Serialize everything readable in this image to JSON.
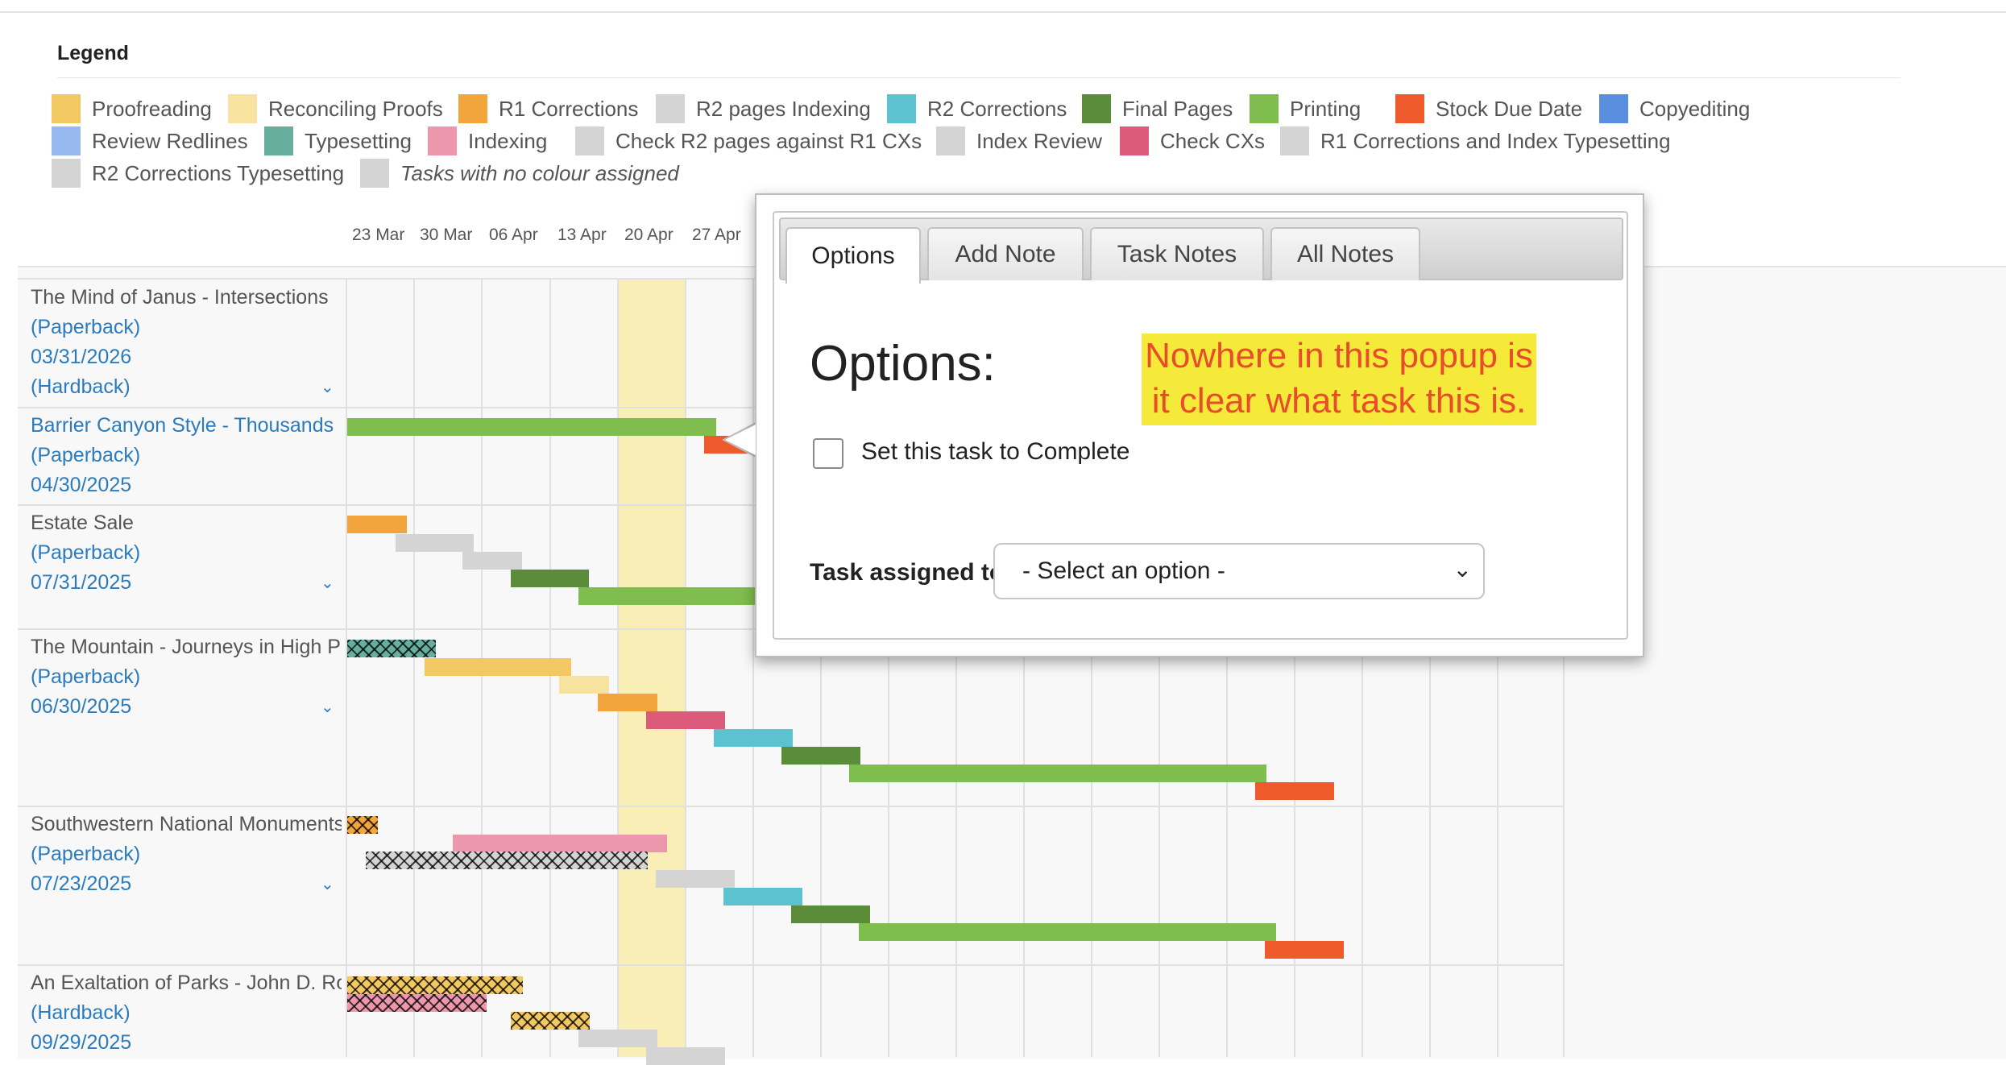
{
  "legend": {
    "title": "Legend",
    "items": [
      {
        "label": "Proofreading",
        "color": "#f2c862"
      },
      {
        "label": "Reconciling Proofs",
        "color": "#f8e2a0"
      },
      {
        "label": "R1 Corrections",
        "color": "#f2a53c"
      },
      {
        "label": "R2 pages Indexing",
        "color": "#d4d4d4"
      },
      {
        "label": "R2 Corrections",
        "color": "#5cc2cf"
      },
      {
        "label": "Final Pages",
        "color": "#5b8c3a"
      },
      {
        "label": "Printing",
        "color": "#7fbd4e"
      },
      {
        "label": "Stock Due Date",
        "color": "#ee5a2b"
      },
      {
        "label": "Copyediting",
        "color": "#5a8fe0"
      },
      {
        "label": "Review Redlines",
        "color": "#98b9f0"
      },
      {
        "label": "Typesetting",
        "color": "#67ae9e"
      },
      {
        "label": "Indexing",
        "color": "#ec97ab"
      },
      {
        "label": "Check R2 pages against R1 CXs",
        "color": "#d4d4d4"
      },
      {
        "label": "Index Review",
        "color": "#d4d4d4"
      },
      {
        "label": "Check CXs",
        "color": "#dc5a7a"
      },
      {
        "label": "R1 Corrections and Index Typesetting",
        "color": "#d4d4d4"
      },
      {
        "label": "R2 Corrections Typesetting",
        "color": "#d4d4d4"
      },
      {
        "label": "Tasks with no colour assigned",
        "color": "#d4d4d4",
        "italic": true
      }
    ]
  },
  "dates": [
    "23 Mar",
    "30 Mar",
    "06 Apr",
    "13 Apr",
    "20 Apr",
    "27 Apr"
  ],
  "rows": [
    {
      "title": "The Mind of Janus - Intersections",
      "lines": [
        "(Paperback)",
        "03/31/2026",
        "(Hardback)"
      ],
      "title_is_link": false
    },
    {
      "title": "Barrier Canyon Style - Thousands",
      "lines": [
        "(Paperback)",
        "04/30/2025"
      ],
      "title_is_link": true
    },
    {
      "title": "Estate Sale",
      "lines": [
        "(Paperback)",
        "07/31/2025"
      ],
      "title_is_link": false
    },
    {
      "title": "The Mountain - Journeys in High Places",
      "lines": [
        "(Paperback)",
        "06/30/2025"
      ],
      "title_is_link": false
    },
    {
      "title": "Southwestern National Monuments",
      "lines": [
        "(Paperback)",
        "07/23/2025"
      ],
      "title_is_link": false
    },
    {
      "title": "An Exaltation of Parks - John D. Rockefeller",
      "lines": [
        "(Hardback)",
        "09/29/2025"
      ],
      "title_is_link": false
    }
  ],
  "expand_icon": "chevron-double-down-icon",
  "popup": {
    "tabs": [
      "Options",
      "Add Note",
      "Task Notes",
      "All Notes"
    ],
    "active_tab": "Options",
    "heading": "Options:",
    "annotation": "Nowhere in this popup is it clear what task this is.",
    "checkbox_label": "Set this task to Complete",
    "checkbox_checked": false,
    "assign_label": "Task assigned to:",
    "select_value": "- Select an option -"
  }
}
